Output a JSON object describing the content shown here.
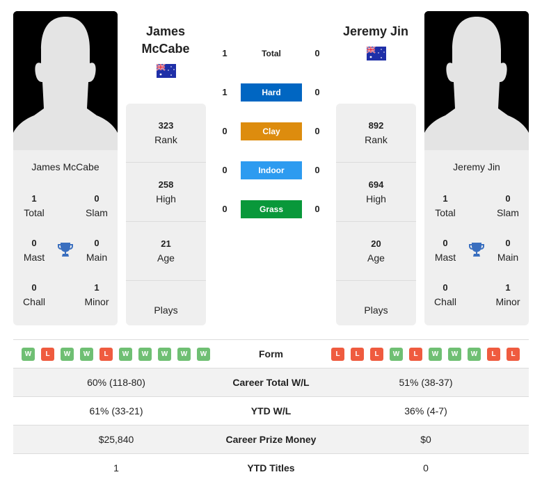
{
  "colors": {
    "hard": "#0066c2",
    "clay": "#dd8c0e",
    "indoor": "#2d9bf0",
    "grass": "#09983a",
    "win": "#6fbf73",
    "loss": "#ef5b3f",
    "trophy": "#3a6fbf"
  },
  "player1": {
    "name": "James McCabe",
    "name_line1": "James",
    "name_line2": "McCabe",
    "flag_icon": "australia-flag-icon",
    "card_name": "James McCabe",
    "titles": {
      "total": {
        "value": "1",
        "label": "Total"
      },
      "slam": {
        "value": "0",
        "label": "Slam"
      },
      "mast": {
        "value": "0",
        "label": "Mast"
      },
      "main": {
        "value": "0",
        "label": "Main"
      },
      "chall": {
        "value": "0",
        "label": "Chall"
      },
      "minor": {
        "value": "1",
        "label": "Minor"
      }
    },
    "stats": {
      "rank": {
        "value": "323",
        "label": "Rank"
      },
      "high": {
        "value": "258",
        "label": "High"
      },
      "age": {
        "value": "21",
        "label": "Age"
      },
      "plays": {
        "value": "",
        "label": "Plays"
      }
    },
    "form": [
      "W",
      "L",
      "W",
      "W",
      "L",
      "W",
      "W",
      "W",
      "W",
      "W"
    ]
  },
  "player2": {
    "name": "Jeremy Jin",
    "flag_icon": "australia-flag-icon",
    "card_name": "Jeremy Jin",
    "titles": {
      "total": {
        "value": "1",
        "label": "Total"
      },
      "slam": {
        "value": "0",
        "label": "Slam"
      },
      "mast": {
        "value": "0",
        "label": "Mast"
      },
      "main": {
        "value": "0",
        "label": "Main"
      },
      "chall": {
        "value": "0",
        "label": "Chall"
      },
      "minor": {
        "value": "1",
        "label": "Minor"
      }
    },
    "stats": {
      "rank": {
        "value": "892",
        "label": "Rank"
      },
      "high": {
        "value": "694",
        "label": "High"
      },
      "age": {
        "value": "20",
        "label": "Age"
      },
      "plays": {
        "value": "",
        "label": "Plays"
      }
    },
    "form": [
      "L",
      "L",
      "L",
      "W",
      "L",
      "W",
      "W",
      "W",
      "L",
      "L"
    ]
  },
  "h2h": [
    {
      "label": "Total",
      "p1": "1",
      "p2": "0"
    },
    {
      "label": "Hard",
      "p1": "1",
      "p2": "0"
    },
    {
      "label": "Clay",
      "p1": "0",
      "p2": "0"
    },
    {
      "label": "Indoor",
      "p1": "0",
      "p2": "0"
    },
    {
      "label": "Grass",
      "p1": "0",
      "p2": "0"
    }
  ],
  "form_label": "Form",
  "comparison": [
    {
      "label": "Career Total W/L",
      "p1": "60% (118-80)",
      "p2": "51% (38-37)"
    },
    {
      "label": "YTD W/L",
      "p1": "61% (33-21)",
      "p2": "36% (4-7)"
    },
    {
      "label": "Career Prize Money",
      "p1": "$25,840",
      "p2": "$0"
    },
    {
      "label": "YTD Titles",
      "p1": "1",
      "p2": "0"
    }
  ]
}
